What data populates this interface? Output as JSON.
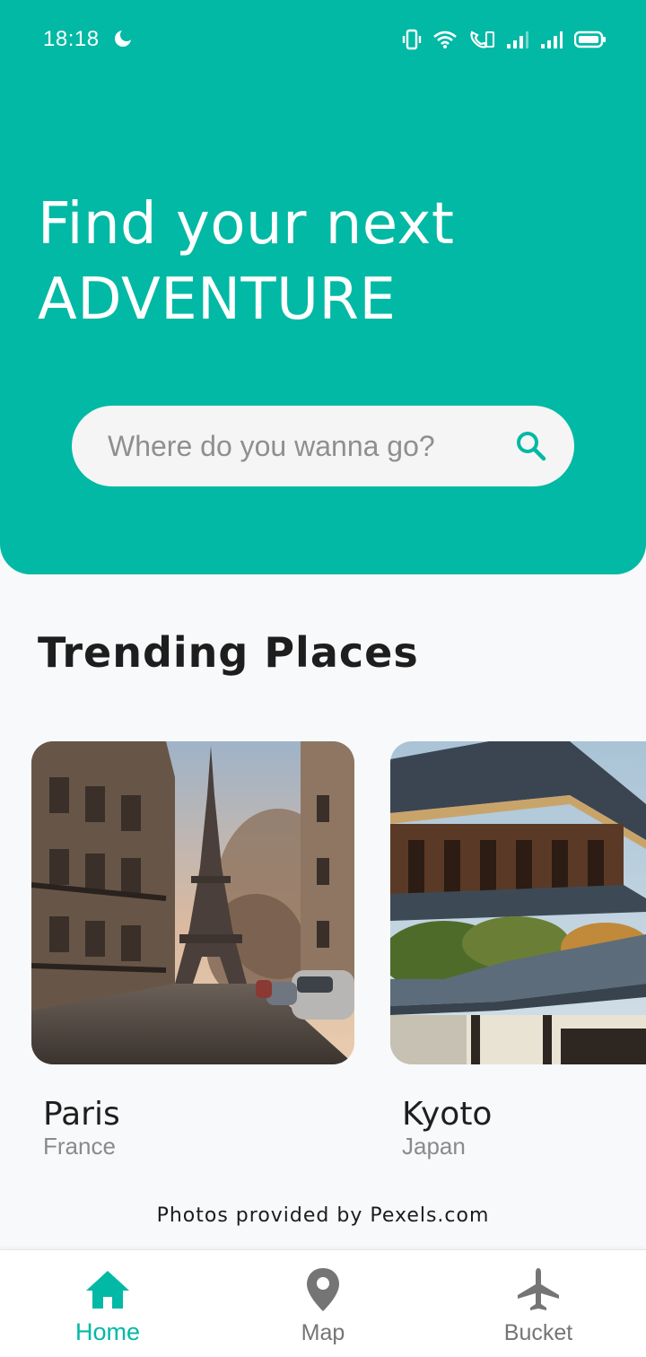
{
  "status_bar": {
    "time": "18:18",
    "icons": [
      "moon-icon",
      "vibrate-icon",
      "wifi-icon",
      "volte-icon",
      "signal-icon",
      "signal-icon",
      "battery-icon"
    ]
  },
  "hero": {
    "headline_line1": "Find your next",
    "headline_line2": "ADVENTURE",
    "background_color": "#01b9a4"
  },
  "search": {
    "placeholder": "Where do you wanna go?",
    "value": "",
    "icon": "search-icon"
  },
  "trending": {
    "title": "Trending Places",
    "places": [
      {
        "name": "Paris",
        "country": "France",
        "image": "eiffel-tower-photo"
      },
      {
        "name": "Kyoto",
        "country": "Japan",
        "image": "japanese-temple-photo"
      }
    ]
  },
  "credits": "Photos provided by Pexels.com",
  "bottom_nav": {
    "items": [
      {
        "label": "Home",
        "icon": "home-icon",
        "active": true
      },
      {
        "label": "Map",
        "icon": "map-pin-icon",
        "active": false
      },
      {
        "label": "Bucket",
        "icon": "airplane-icon",
        "active": false
      }
    ],
    "active_color": "#01b9a4",
    "inactive_color": "#757575"
  }
}
